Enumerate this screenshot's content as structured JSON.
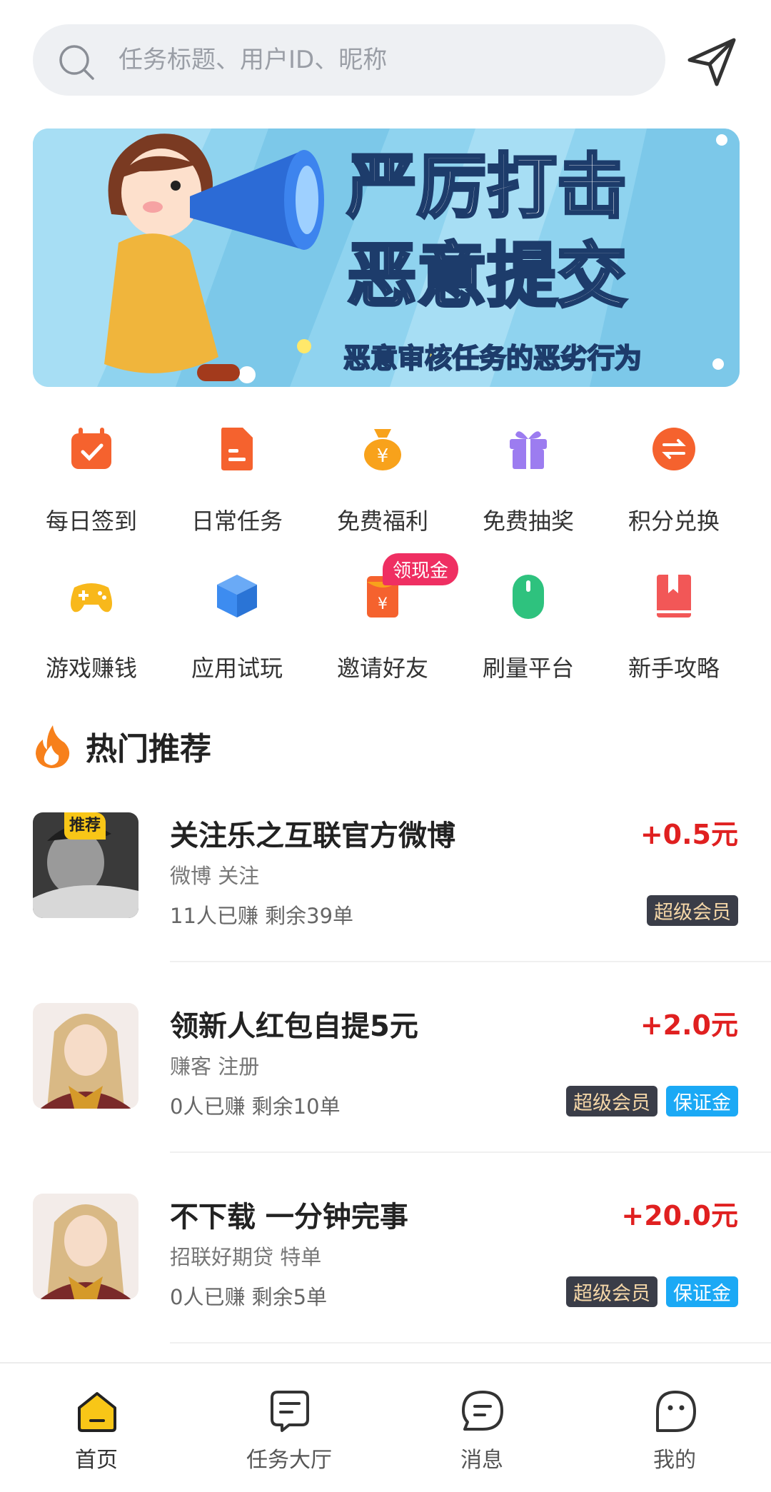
{
  "search": {
    "placeholder": "任务标题、用户ID、昵称"
  },
  "banner": {
    "line1": "严厉打击",
    "line2": "恶意提交",
    "caption": "恶意审核任务的恶劣行为"
  },
  "grid": [
    {
      "label": "每日签到",
      "icon": "calendar-check-icon",
      "color": "#f5622e"
    },
    {
      "label": "日常任务",
      "icon": "document-icon",
      "color": "#f5622e"
    },
    {
      "label": "免费福利",
      "icon": "money-bag-icon",
      "color": "#f8a21b"
    },
    {
      "label": "免费抽奖",
      "icon": "gift-icon",
      "color": "#9c7cf0"
    },
    {
      "label": "积分兑换",
      "icon": "exchange-icon",
      "color": "#f5622e"
    },
    {
      "label": "游戏赚钱",
      "icon": "gamepad-icon",
      "color": "#f8b81b"
    },
    {
      "label": "应用试玩",
      "icon": "cube-icon",
      "color": "#3d8cf0"
    },
    {
      "label": "邀请好友",
      "icon": "red-envelope-icon",
      "color": "#f5622e"
    },
    {
      "label": "刷量平台",
      "icon": "mouse-icon",
      "color": "#2ec27e"
    },
    {
      "label": "新手攻略",
      "icon": "book-icon",
      "color": "#f25757"
    }
  ],
  "invite_badge": "领现金",
  "section": {
    "title": "热门推荐"
  },
  "tasks": [
    {
      "title": "关注乐之互联官方微博",
      "subtitle": "微博   关注",
      "stats": "11人已赚   剩余39单",
      "price": "+0.5元",
      "recommend_tag": "推荐",
      "tags": [
        "超级会员"
      ]
    },
    {
      "title": "领新人红包自提5元",
      "subtitle": "赚客   注册",
      "stats": "0人已赚   剩余10单",
      "price": "+2.0元",
      "tags": [
        "超级会员",
        "保证金"
      ]
    },
    {
      "title": "不下载 一分钟完事",
      "subtitle": "招联好期贷   特单",
      "stats": "0人已赚   剩余5单",
      "price": "+20.0元",
      "tags": [
        "超级会员",
        "保证金"
      ]
    }
  ],
  "tabs": [
    {
      "label": "首页",
      "icon": "home-icon"
    },
    {
      "label": "任务大厅",
      "icon": "task-hall-icon"
    },
    {
      "label": "消息",
      "icon": "message-icon"
    },
    {
      "label": "我的",
      "icon": "profile-icon"
    }
  ],
  "colors": {
    "price": "#e02020",
    "active_tab": "#f8c617",
    "vip_tag_bg": "#3a3d48",
    "deposit_tag_bg": "#1ba9f5"
  }
}
